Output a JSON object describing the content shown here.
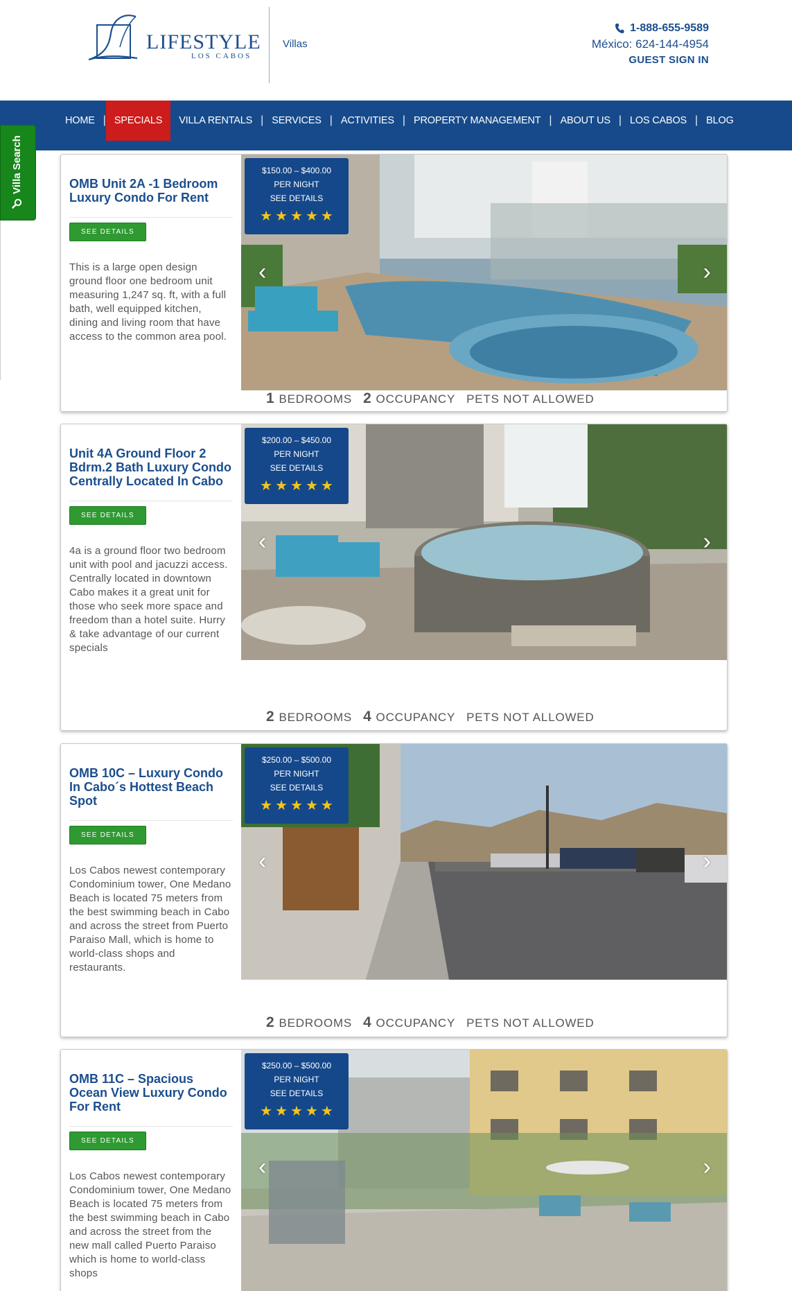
{
  "header": {
    "logo_text": "LIFESTYLE",
    "logo_sub": "LOS CABOS",
    "section": "Villas",
    "phone": "1-888-655-9589",
    "mexico_phone": "México: 624-144-4954",
    "sign_in": "GUEST SIGN IN"
  },
  "nav": {
    "items": [
      {
        "label": "HOME"
      },
      {
        "label": "SPECIALS"
      },
      {
        "label": "VILLA RENTALS"
      },
      {
        "label": "SERVICES"
      },
      {
        "label": "ACTIVITIES"
      },
      {
        "label": "PROPERTY MANAGEMENT"
      },
      {
        "label": "ABOUT US"
      },
      {
        "label": "LOS CABOS"
      },
      {
        "label": "BLOG"
      }
    ],
    "active": "SPECIALS"
  },
  "villa_search": {
    "label": "Villa Search"
  },
  "listings": [
    {
      "title": "OMB Unit 2A -1 Bedroom Luxury Condo For Rent",
      "button": "SEE DETAILS",
      "description": "This is a large open design ground floor one bedroom unit measuring 1,247 sq. ft, with a full bath, well equipped kitchen, dining and living room that have access to the common area pool.",
      "price": "$150.00 – $400.00",
      "per_night": "PER NIGHT",
      "see_details": "SEE DETAILS",
      "rating": 5,
      "bedrooms": "1",
      "bedrooms_label": "BEDROOMS",
      "occupancy": "2",
      "occupancy_label": "OCCUPANCY",
      "pets": "PETS NOT ALLOWED"
    },
    {
      "title": "Unit 4A Ground Floor 2 Bdrm.2 Bath Luxury Condo Centrally Located In Cabo",
      "button": "SEE DETAILS",
      "description": "4a is a ground floor two bedroom unit with pool and jacuzzi access. Centrally located in downtown Cabo makes it a great unit for those who seek more space and freedom than a hotel suite. Hurry & take advantage of our current specials",
      "price": "$200.00 – $450.00",
      "per_night": "PER NIGHT",
      "see_details": "SEE DETAILS",
      "rating": 5,
      "bedrooms": "2",
      "bedrooms_label": "BEDROOMS",
      "occupancy": "4",
      "occupancy_label": "OCCUPANCY",
      "pets": "PETS NOT ALLOWED"
    },
    {
      "title": "OMB 10C – Luxury Condo In Cabo´s Hottest Beach Spot",
      "button": "SEE DETAILS",
      "description": "Los Cabos newest contemporary Condominium tower, One Medano Beach is located 75 meters from the best swimming beach in Cabo and across the street from Puerto Paraiso Mall, which is home to world-class shops and restaurants.",
      "price": "$250.00 – $500.00",
      "per_night": "PER NIGHT",
      "see_details": "SEE DETAILS",
      "rating": 5,
      "bedrooms": "2",
      "bedrooms_label": "BEDROOMS",
      "occupancy": "4",
      "occupancy_label": "OCCUPANCY",
      "pets": "PETS NOT ALLOWED"
    },
    {
      "title": "OMB 11C – Spacious Ocean View Luxury Condo For Rent",
      "button": "SEE DETAILS",
      "description": "Los Cabos newest contemporary Condominium tower, One Medano Beach is located 75 meters from the best swimming beach in Cabo and across the street from the new mall called Puerto Paraiso which is home to world-class shops",
      "price": "$250.00 – $500.00",
      "per_night": "PER NIGHT",
      "see_details": "SEE DETAILS",
      "rating": 5
    }
  ],
  "colors": {
    "brand_blue": "#174a8b",
    "active_red": "#cc1c1c",
    "button_green": "#2e9a31",
    "star_yellow": "#f5c518"
  }
}
